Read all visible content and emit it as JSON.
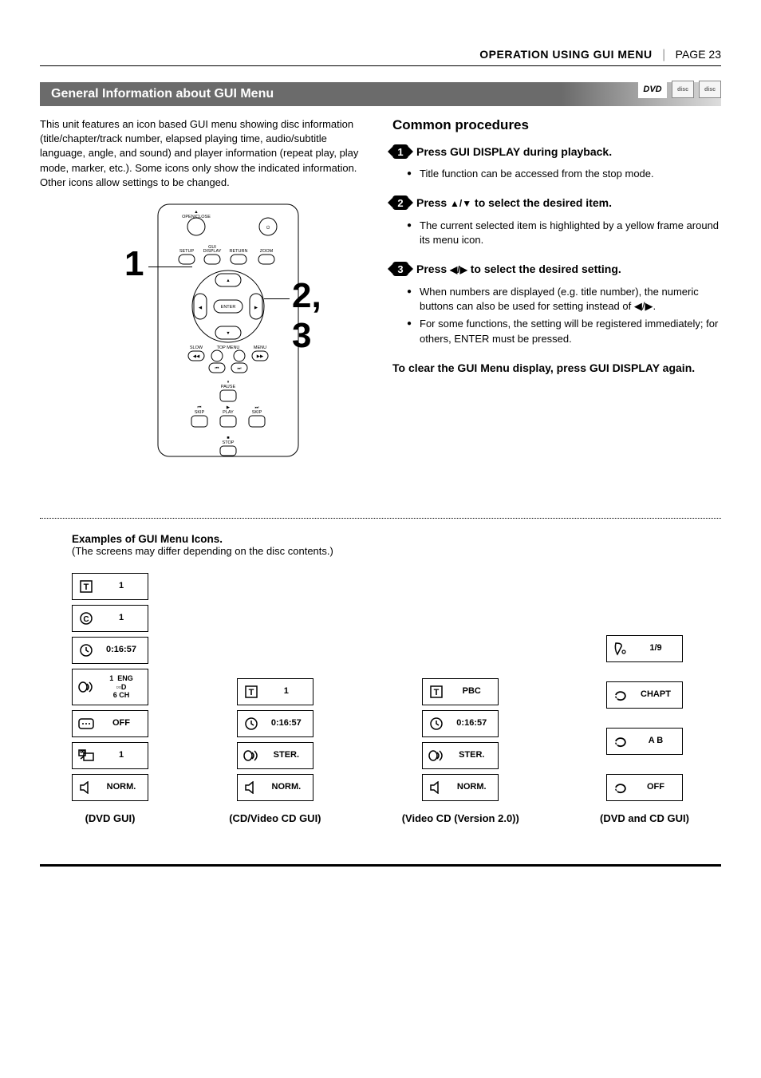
{
  "header": {
    "section": "OPERATION USING GUI MENU",
    "page": "PAGE 23"
  },
  "title": "General Information about GUI Menu",
  "logos": {
    "dvd": "DVD",
    "disc1": "disc",
    "disc2": "disc"
  },
  "intro": "This unit features an icon based GUI menu showing disc information (title/chapter/track number, elapsed playing time, audio/subtitle language, angle, and sound) and player information (repeat play, play mode, marker, etc.). Some icons only show the indicated information. Other icons allow settings to be changed.",
  "callouts": {
    "one": "1",
    "twothree": "2, 3"
  },
  "remote_labels": {
    "open_close": "OPEN/CLOSE",
    "setup": "SETUP",
    "gui_display": "GUI DISPLAY",
    "return": "RETURN",
    "zoom": "ZOOM",
    "enter": "ENTER",
    "slow": "SLOW",
    "top_menu": "TOP MENU",
    "menu": "MENU",
    "pause": "PAUSE",
    "skip_back": "SKIP",
    "play": "PLAY",
    "skip_fwd": "SKIP",
    "stop": "STOP"
  },
  "common": {
    "heading": "Common procedures",
    "step1": {
      "num": "1",
      "text": "Press GUI DISPLAY during playback.",
      "bullets": [
        "Title function can be accessed from the stop mode."
      ]
    },
    "step2": {
      "num": "2",
      "text_a": "Press ",
      "text_b": " to select the desired item.",
      "bullets": [
        "The current selected item is highlighted by a yellow frame around its menu icon."
      ]
    },
    "step3": {
      "num": "3",
      "text_a": "Press ",
      "text_b": " to select the desired setting.",
      "bullets": [
        "When numbers are displayed (e.g. title number), the numeric buttons can also be used for setting instead of ◀/▶.",
        "For some functions, the setting will be registered immediately; for others, ENTER must be pressed."
      ]
    },
    "clear": "To clear the GUI Menu display, press GUI DISPLAY again."
  },
  "examples": {
    "title": "Examples of GUI Menu Icons.",
    "sub": "(The screens may differ depending on the disc contents.)",
    "cols": {
      "dvd_gui": {
        "caption": "(DVD GUI)",
        "items": [
          {
            "glyph": "title",
            "label": "1"
          },
          {
            "glyph": "chapter",
            "label": "1"
          },
          {
            "glyph": "clock",
            "label": "0:16:57"
          },
          {
            "glyph": "audio",
            "label": "1 ENG ⬜⬜D 6 CH",
            "tall": true
          },
          {
            "glyph": "subtitle",
            "label": "OFF"
          },
          {
            "glyph": "angle",
            "label": "1"
          },
          {
            "glyph": "speaker",
            "label": "NORM."
          }
        ]
      },
      "cd_video": {
        "caption": "(CD/Video CD GUI)",
        "items": [
          {
            "glyph": "title",
            "label": "1"
          },
          {
            "glyph": "clock",
            "label": "0:16:57"
          },
          {
            "glyph": "audio",
            "label": "STER."
          },
          {
            "glyph": "speaker",
            "label": "NORM."
          }
        ]
      },
      "vcd2": {
        "caption": "(Video CD (Version 2.0))",
        "items": [
          {
            "glyph": "title",
            "label": "PBC"
          },
          {
            "glyph": "clock",
            "label": "0:16:57"
          },
          {
            "glyph": "audio",
            "label": "STER."
          },
          {
            "glyph": "speaker",
            "label": "NORM."
          }
        ]
      },
      "dvd_cd": {
        "caption": "(DVD and CD GUI)",
        "items": [
          {
            "glyph": "marker",
            "label": "1/9"
          },
          {
            "glyph": "repeat",
            "label": "CHAPT"
          },
          {
            "glyph": "repeat",
            "label": "A    B"
          },
          {
            "glyph": "repeat",
            "label": "OFF"
          }
        ]
      }
    }
  }
}
